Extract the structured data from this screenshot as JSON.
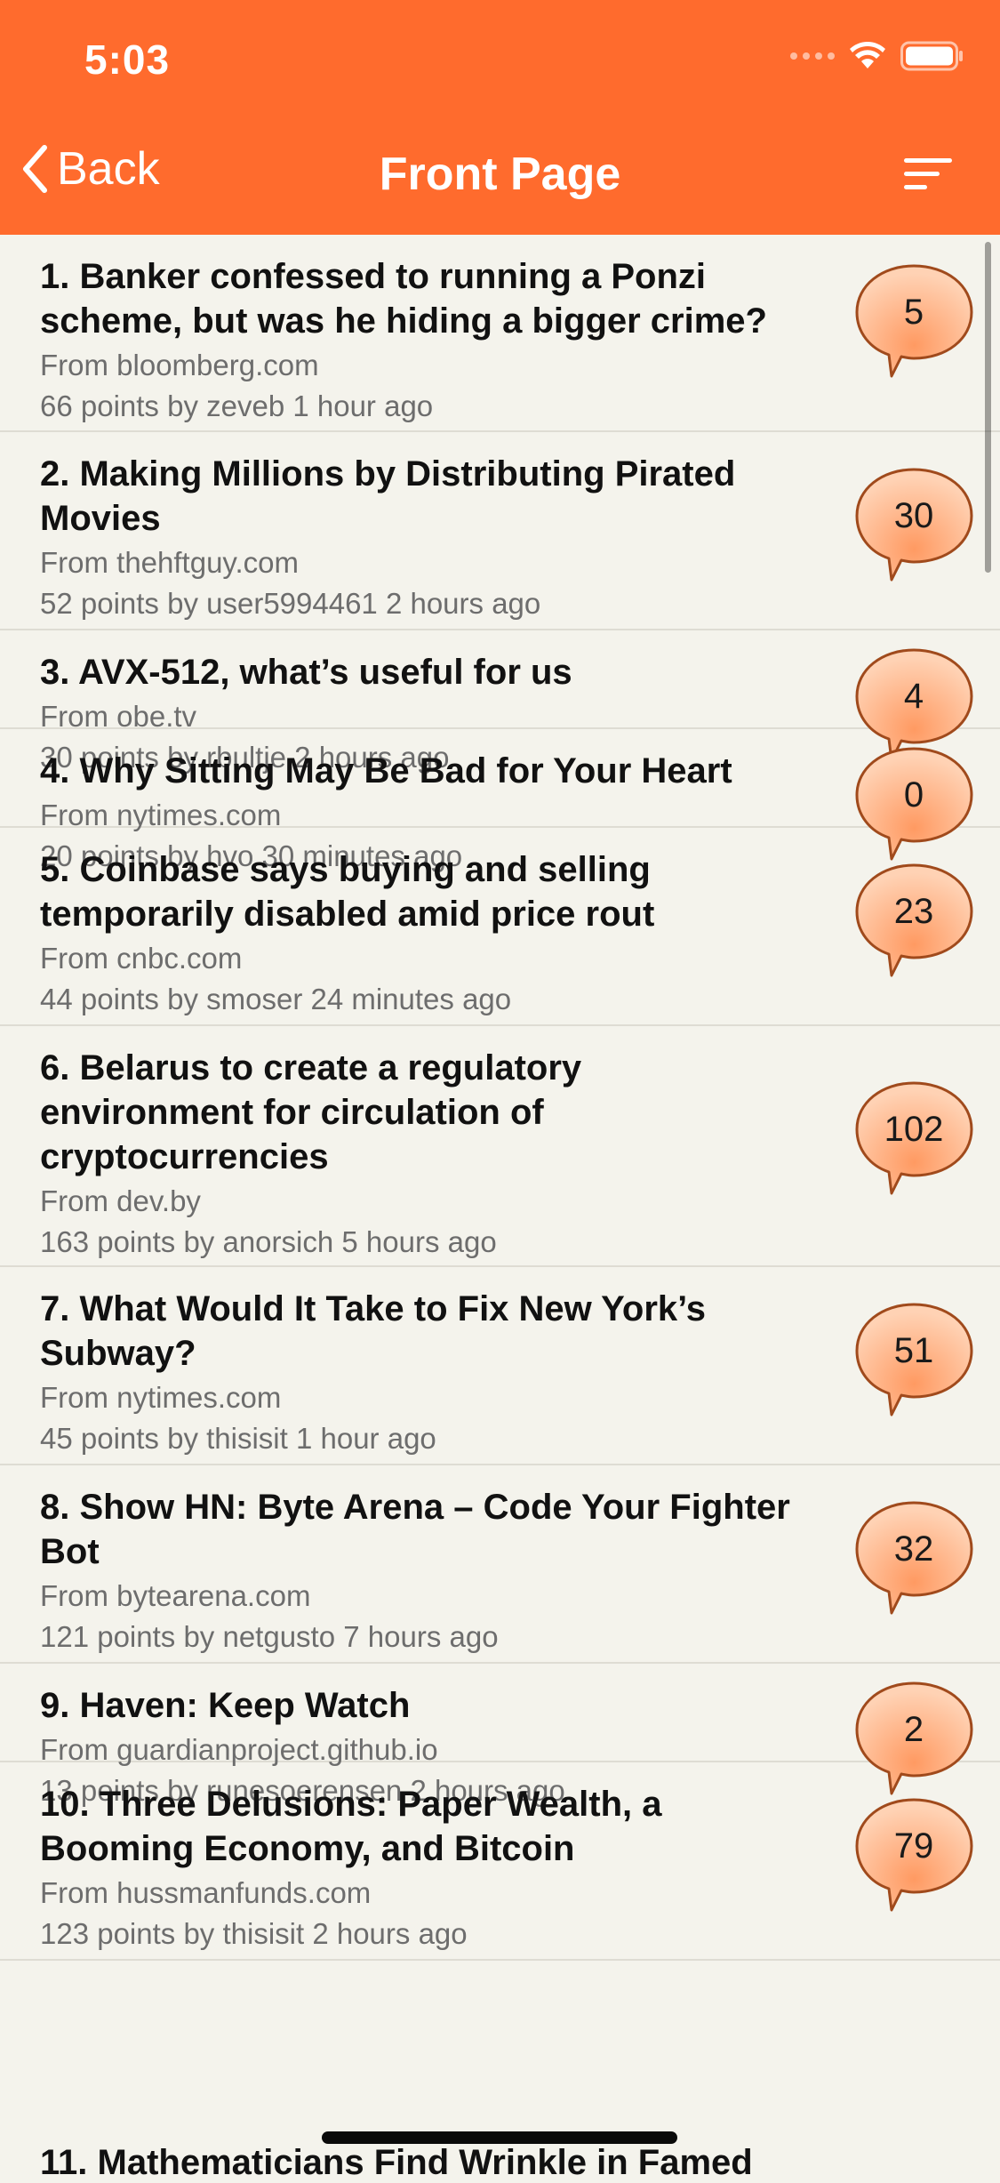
{
  "status_bar": {
    "time": "5:03"
  },
  "nav": {
    "back_label": "Back",
    "title": "Front Page"
  },
  "colors": {
    "accent": "#ff6b2d",
    "background": "#f4f3ec",
    "bubble_fill": "#ffb58c",
    "bubble_stroke": "#a04a1c"
  },
  "stories": [
    {
      "title": "1. Banker confessed to running a Ponzi scheme, but was he hiding a bigger crime?",
      "domain": "From bloomberg.com",
      "meta": "66 points by zeveb 1 hour ago",
      "comments": "5"
    },
    {
      "title": "2. Making Millions by Distributing Pirated Movies",
      "domain": "From thehftguy.com",
      "meta": "52 points by user5994461 2 hours ago",
      "comments": "30"
    },
    {
      "title": "3. AVX-512, what’s useful for us",
      "domain": "From obe.tv",
      "meta": "30 points by rbultje 2 hours ago",
      "comments": "4"
    },
    {
      "title": "4. Why Sitting May Be Bad for Your Heart",
      "domain": "From nytimes.com",
      "meta": "20 points by hvo 30 minutes ago",
      "comments": "0"
    },
    {
      "title": "5. Coinbase says buying and selling temporarily disabled amid price rout",
      "domain": "From cnbc.com",
      "meta": "44 points by smoser 24 minutes ago",
      "comments": "23"
    },
    {
      "title": "6. Belarus to create a regulatory environment for circulation of cryptocurrencies",
      "domain": "From dev.by",
      "meta": "163 points by anorsich 5 hours ago",
      "comments": "102"
    },
    {
      "title": "7. What Would It Take to Fix New York’s Subway?",
      "domain": "From nytimes.com",
      "meta": "45 points by thisisit 1 hour ago",
      "comments": "51"
    },
    {
      "title": "8. Show HN: Byte Arena – Code Your Fighter Bot",
      "domain": "From bytearena.com",
      "meta": "121 points by netgusto 7 hours ago",
      "comments": "32"
    },
    {
      "title": "9. Haven: Keep Watch",
      "domain": "From guardianproject.github.io",
      "meta": "13 points by runesoerensen 2 hours ago",
      "comments": "2"
    },
    {
      "title": "10. Three Delusions: Paper Wealth, a Booming Economy, and Bitcoin",
      "domain": "From hussmanfunds.com",
      "meta": "123 points by thisisit 2 hours ago",
      "comments": "79"
    }
  ],
  "partial_story_title": "11. Mathematicians Find Wrinkle in Famed"
}
